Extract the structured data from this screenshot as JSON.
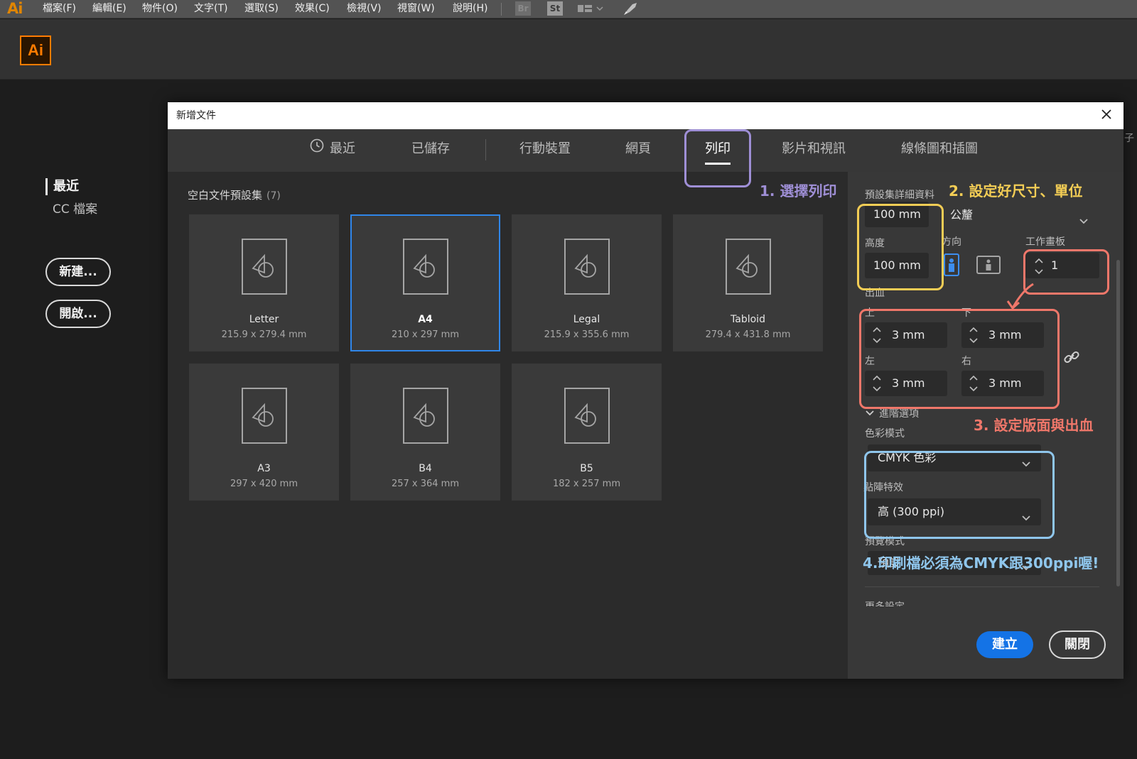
{
  "menubar": {
    "logo": "Ai",
    "items": [
      "檔案(F)",
      "編輯(E)",
      "物件(O)",
      "文字(T)",
      "選取(S)",
      "效果(C)",
      "檢視(V)",
      "視窗(W)",
      "說明(H)"
    ],
    "bridge_label": "Br",
    "stock_label": "St"
  },
  "app": {
    "logo_text": "Ai",
    "accent": "#ff7c00"
  },
  "left_nav": {
    "recent": "最近",
    "cc_files": "CC 檔案",
    "new_button": "新建...",
    "open_button": "開啟..."
  },
  "dialog": {
    "title": "新增文件",
    "tabs": [
      "最近",
      "已儲存",
      "行動裝置",
      "網頁",
      "列印",
      "影片和視訊",
      "線條圖和插圖"
    ],
    "active_tab": "列印",
    "preset_heading": "空白文件預設集",
    "preset_count": "(7)",
    "presets": [
      {
        "name": "Letter",
        "size": "215.9 x 279.4 mm"
      },
      {
        "name": "A4",
        "size": "210 x 297 mm"
      },
      {
        "name": "Legal",
        "size": "215.9 x 355.6 mm"
      },
      {
        "name": "Tabloid",
        "size": "279.4 x 431.8 mm"
      },
      {
        "name": "A3",
        "size": "297 x 420 mm"
      },
      {
        "name": "B4",
        "size": "257 x 364 mm"
      },
      {
        "name": "B5",
        "size": "182 x 257 mm"
      }
    ],
    "selected_preset": "A4",
    "details": {
      "heading": "預設集詳細資料",
      "width_value": "100 mm",
      "units": "公釐",
      "height_label": "高度",
      "height_value": "100 mm",
      "orientation_label": "方向",
      "artboards_label": "工作畫板",
      "artboards_value": "1",
      "bleed_label": "出血",
      "bleed_top_label": "上",
      "bleed_top": "3 mm",
      "bleed_bottom_label": "下",
      "bleed_bottom": "3 mm",
      "bleed_left_label": "左",
      "bleed_left": "3 mm",
      "bleed_right_label": "右",
      "bleed_right": "3 mm",
      "advanced_label": "進階選項",
      "color_mode_label": "色彩模式",
      "color_mode": "CMYK 色彩",
      "raster_label": "點陣特效",
      "raster": "高 (300 ppi)",
      "preview_label": "預覽模式",
      "preview": "預設",
      "cut_label": "更多設定"
    },
    "create_button": "建立",
    "close_button": "關閉"
  },
  "annotations": {
    "step1": "1. 選擇列印",
    "step2": "2. 設定好尺寸、單位",
    "step3": "3. 設定版面與出血",
    "step4": "4.印刷檔必須為CMYK跟300ppi喔!",
    "colors": {
      "purple": "#9f8fd6",
      "yellow": "#f3cd55",
      "red": "#f0776a",
      "blue": "#8fc6ec"
    }
  },
  "edge_char": "子"
}
